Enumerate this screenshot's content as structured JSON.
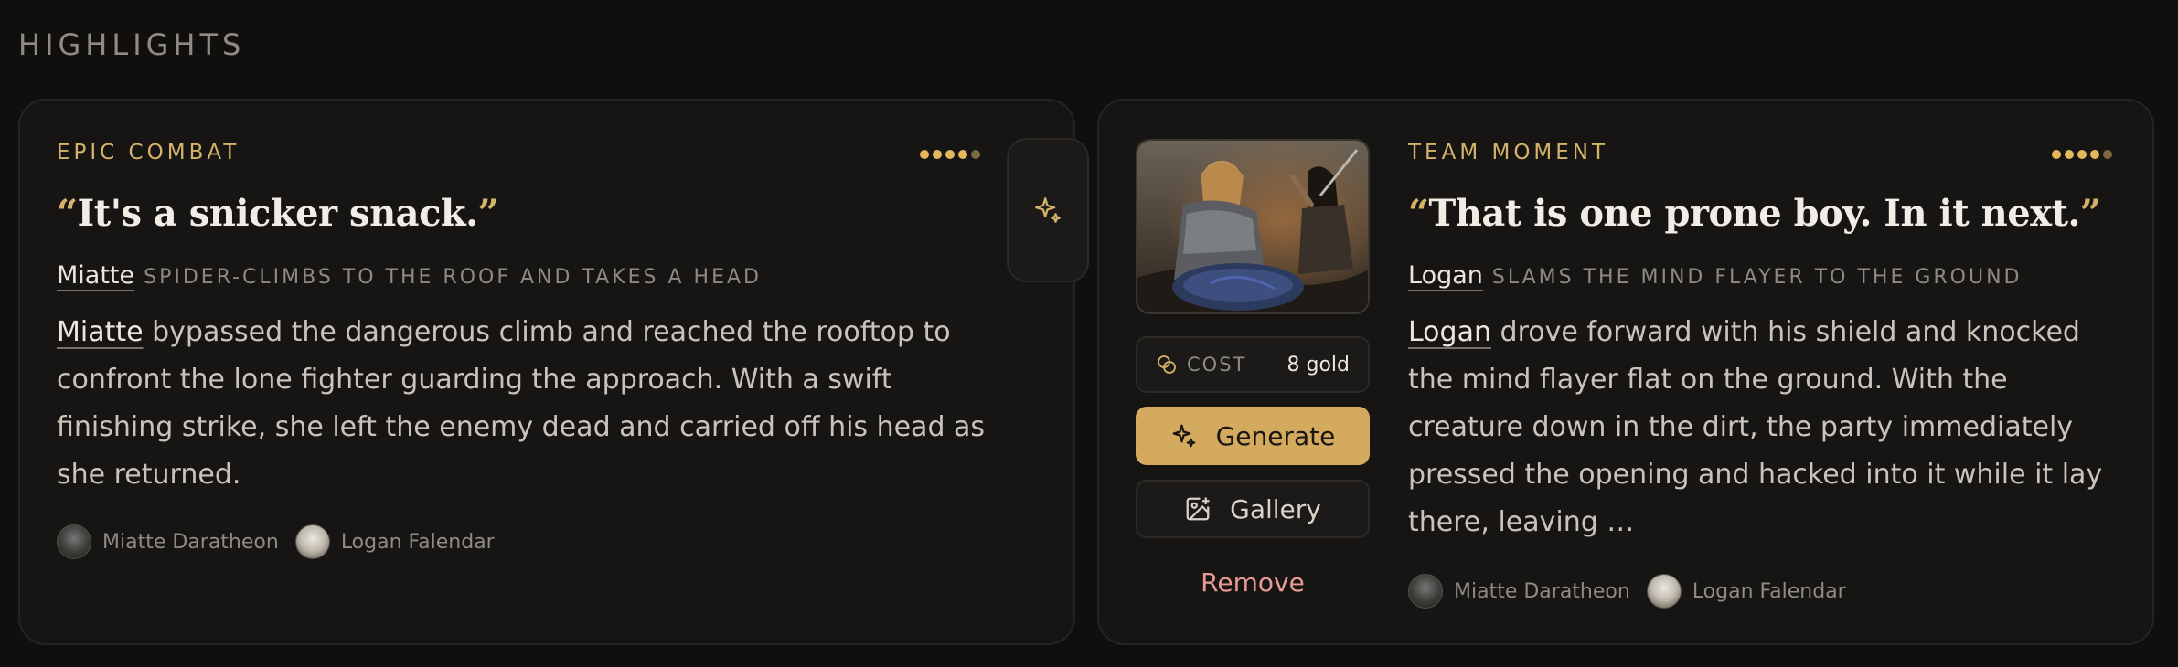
{
  "section": {
    "title": "HIGHLIGHTS"
  },
  "colors": {
    "accent": "#d6b36a",
    "button_gold": "#d4aa5f",
    "remove": "#e79a94",
    "background": "#100f0e"
  },
  "cards": [
    {
      "kicker": "EPIC COMBAT",
      "rating": {
        "filled": 4,
        "total": 5
      },
      "quote_open": "“",
      "quote": "It's a snicker snack.",
      "quote_close": "”",
      "actor": "Miatte",
      "action": "SPIDER-CLIMBS TO THE ROOF AND TAKES A HEAD",
      "body_actor": "Miatte",
      "body": " bypassed the dangerous climb and reached the rooftop to confront the lone fighter guarding the approach. With a swift finishing strike, she left the enemy dead and carried off his head as she returned.",
      "characters": [
        "Miatte Daratheon",
        "Logan Falendar"
      ],
      "side_icon": "sparkle-icon"
    },
    {
      "kicker": "TEAM MOMENT",
      "rating": {
        "filled": 4,
        "total": 5
      },
      "quote_open": "“",
      "quote": "That is one prone boy. In it next.",
      "quote_close": "”",
      "actor": "Logan",
      "action": "SLAMS THE MIND FLAYER TO THE GROUND",
      "body_actor": "Logan",
      "body": " drove forward with his shield and knocked the mind flayer flat on the ground. With the creature down in the dirt, the party immediately pressed the opening and hacked into it while it lay there, leaving …",
      "characters": [
        "Miatte Daratheon",
        "Logan Falendar"
      ],
      "image": {
        "icon": "battle-scene-image"
      },
      "cost": {
        "label": "COST",
        "value": "8 gold",
        "icon": "coins-icon"
      },
      "generate_label": "Generate",
      "gallery_label": "Gallery",
      "remove_label": "Remove"
    }
  ]
}
